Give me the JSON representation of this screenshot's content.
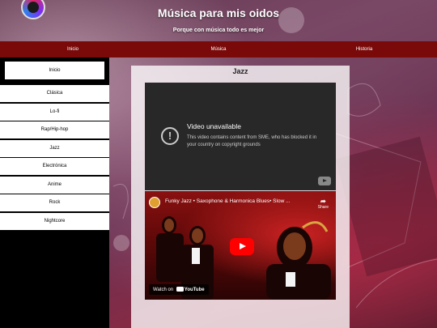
{
  "site": {
    "title": "Música para mis oidos",
    "subtitle": "Porque con música todo es mejor"
  },
  "top_nav": {
    "items": [
      {
        "label": "Inicio"
      },
      {
        "label": "Música"
      },
      {
        "label": "Historia"
      }
    ]
  },
  "sidebar": {
    "items": [
      {
        "label": "Inicio"
      },
      {
        "label": "Clásica"
      },
      {
        "label": "Lo-fi"
      },
      {
        "label": "Rap/Hip-hop"
      },
      {
        "label": "Jazz"
      },
      {
        "label": "Electrónica"
      },
      {
        "label": "Anime"
      },
      {
        "label": "Rock"
      },
      {
        "label": "Nightcore"
      }
    ]
  },
  "main": {
    "section_title": "Jazz",
    "video1": {
      "error_title": "Video unavailable",
      "error_message": "This video contains content from SME, who has blocked it in your country on copyright grounds"
    },
    "video2": {
      "title": "Funky Jazz • Saxophone & Harmonica Blues• Slow ...",
      "share_label": "Share",
      "watch_on_label": "Watch on",
      "youtube_label": "YouTube"
    }
  },
  "colors": {
    "nav_bg": "#7a0a0a",
    "play_red": "#ff0000"
  }
}
